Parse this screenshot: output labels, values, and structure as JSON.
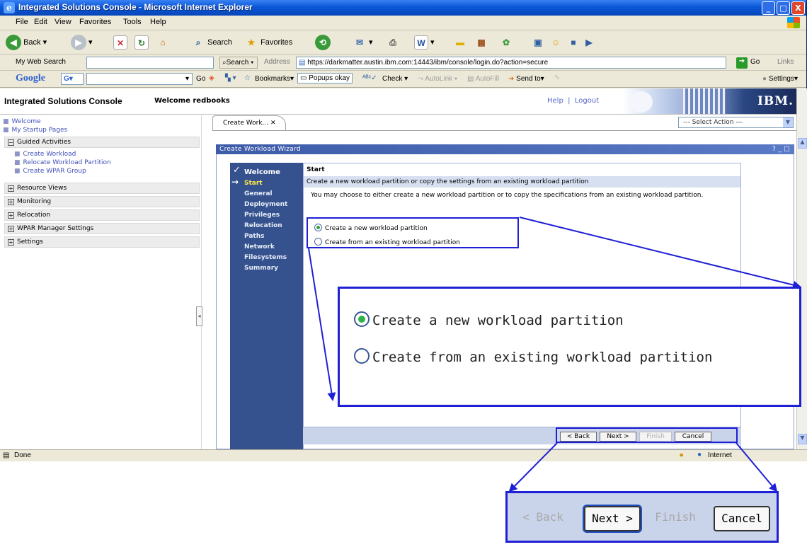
{
  "window": {
    "title": "Integrated Solutions Console - Microsoft Internet Explorer",
    "controls": [
      "_",
      "□",
      "X"
    ]
  },
  "menu": [
    "File",
    "Edit",
    "View",
    "Favorites",
    "Tools",
    "Help"
  ],
  "toolbar": {
    "back": "Back",
    "search": "Search",
    "favorites": "Favorites"
  },
  "address_bar": {
    "my_web_search": "My Web Search",
    "search_button": "Search",
    "address_label": "Address",
    "url": "https://darkmatter.austin.ibm.com:14443/ibm/console/login.do?action=secure",
    "go": "Go",
    "links": "Links"
  },
  "google_bar": {
    "logo": "Google",
    "g_button": "G",
    "go": "Go",
    "bookmarks": "Bookmarks",
    "popups": "Popups okay",
    "check": "Check",
    "autolink": "AutoLink",
    "autofill": "AutoFill",
    "send_to": "Send to",
    "settings": "Settings"
  },
  "console": {
    "brand": "Integrated Solutions Console",
    "welcome": "Welcome redbooks",
    "help": "Help",
    "separator": "|",
    "logout": "Logout",
    "ibm_logo": "IBM."
  },
  "nav": {
    "top_links": [
      "Welcome",
      "My Startup Pages"
    ],
    "guided_activities": {
      "label": "Guided Activities",
      "items": [
        "Create Workload",
        "Relocate Workload Partition",
        "Create WPAR Group"
      ]
    },
    "sections": [
      "Resource Views",
      "Monitoring",
      "Relocation",
      "WPAR Manager Settings",
      "Settings"
    ]
  },
  "tab": {
    "label": "Create Work...",
    "close": "✕"
  },
  "select_action": "--- Select Action ---",
  "wizard": {
    "title": "Create Workload Wizard",
    "title_controls": "? _ □",
    "steps": [
      "Welcome",
      "Start",
      "General",
      "Deployment",
      "Privileges",
      "Relocation",
      "Paths",
      "Network",
      "Filesystems",
      "Summary"
    ],
    "current_step": "Start",
    "heading": "Start",
    "subheading": "Create a new workload partition or copy the settings from an existing workload partition",
    "description": "You may choose to either create a new workload partition or to copy the specifications from an existing workload partition.",
    "options": [
      {
        "label": "Create a new workload partition",
        "selected": true
      },
      {
        "label": "Create from an existing workload partition",
        "selected": false
      }
    ],
    "buttons": {
      "back": "< Back",
      "next": "Next >",
      "finish": "Finish",
      "cancel": "Cancel"
    }
  },
  "status": {
    "text": "Done",
    "zone": "Internet"
  },
  "callouts": {
    "radios": [
      {
        "label": "Create a new workload partition",
        "selected": true
      },
      {
        "label": "Create from an existing workload partition",
        "selected": false
      }
    ],
    "buttons": {
      "back": "< Back",
      "next": "Next >",
      "finish": "Finish",
      "cancel": "Cancel"
    }
  },
  "colors": {
    "ie_title": "#0a58d8",
    "callout": "#1f1fd6",
    "wizard_nav": "#35528e",
    "link": "#4050b8"
  }
}
